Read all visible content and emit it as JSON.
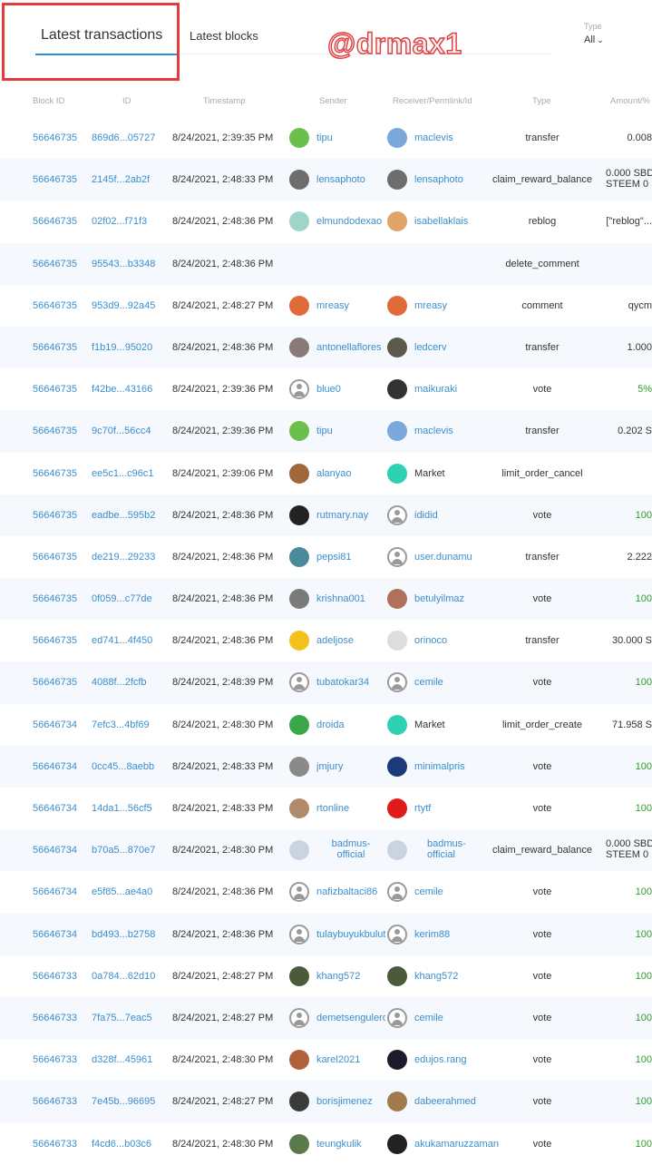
{
  "header": {
    "tab_active": "Latest transactions",
    "tab_other": "Latest blocks",
    "watermark": "@drmax1",
    "type_label": "Type",
    "type_value": "All"
  },
  "columns": [
    "Block ID",
    "ID",
    "Timestamp",
    "Sender",
    "Receiver/Permlink/Id",
    "Type",
    "Amount/%"
  ],
  "colors": {
    "link": "#3a8fcf",
    "accent": "#2a8fd4",
    "highlight_box": "#e23b3b",
    "green_value": "#2e9e2e",
    "row_alt": "#f5f8fc"
  },
  "rows": [
    {
      "block": "56646735",
      "id": "869d6...05727",
      "ts": "8/24/2021, 2:39:35 PM",
      "sender": "tipu",
      "receiver": "maclevis",
      "type": "transfer",
      "amount": "0.008",
      "s_av": "#6bbf4a",
      "r_av": "#7aa8d8"
    },
    {
      "block": "56646735",
      "id": "2145f...2ab2f",
      "ts": "8/24/2021, 2:48:33 PM",
      "sender": "lensaphoto",
      "receiver": "lensaphoto",
      "type": "claim_reward_balance",
      "amount": "0.000 SBD",
      "amount2": "STEEM 0",
      "s_av": "#6d6d6d",
      "r_av": "#6d6d6d"
    },
    {
      "block": "56646735",
      "id": "02f02...f71f3",
      "ts": "8/24/2021, 2:48:36 PM",
      "sender": "elmundodexao",
      "receiver": "isabellaklais",
      "type": "reblog",
      "amount": "[\"reblog\"...",
      "s_av": "#9fd4c9",
      "r_av": "#e0a36a"
    },
    {
      "block": "56646735",
      "id": "95543...b3348",
      "ts": "8/24/2021, 2:48:36 PM",
      "sender": "",
      "receiver": "",
      "type": "delete_comment",
      "amount": ""
    },
    {
      "block": "56646735",
      "id": "953d9...92a45",
      "ts": "8/24/2021, 2:48:27 PM",
      "sender": "mreasy",
      "receiver": "mreasy",
      "type": "comment",
      "amount": "qycm",
      "s_av": "#e06b3a",
      "r_av": "#e06b3a"
    },
    {
      "block": "56646735",
      "id": "f1b19...95020",
      "ts": "8/24/2021, 2:48:36 PM",
      "sender": "antonellaflores",
      "receiver": "ledcerv",
      "type": "transfer",
      "amount": "1.000",
      "s_av": "#8a7a7a",
      "r_av": "#5a5a4a"
    },
    {
      "block": "56646735",
      "id": "f42be...43166",
      "ts": "8/24/2021, 2:39:36 PM",
      "sender": "blue0",
      "receiver": "maikuraki",
      "type": "vote",
      "amount": "5%",
      "green": true,
      "s_av": "default",
      "r_av": "#333333"
    },
    {
      "block": "56646735",
      "id": "9c70f...56cc4",
      "ts": "8/24/2021, 2:39:36 PM",
      "sender": "tipu",
      "receiver": "maclevis",
      "type": "transfer",
      "amount": "0.202 S",
      "s_av": "#6bbf4a",
      "r_av": "#7aa8d8"
    },
    {
      "block": "56646735",
      "id": "ee5c1...c96c1",
      "ts": "8/24/2021, 2:39:06 PM",
      "sender": "alanyao",
      "receiver": "Market",
      "receiver_plain": true,
      "type": "limit_order_cancel",
      "amount": "",
      "s_av": "#a0673a",
      "r_av": "#2fd1b4"
    },
    {
      "block": "56646735",
      "id": "eadbe...595b2",
      "ts": "8/24/2021, 2:48:36 PM",
      "sender": "rutmary.nay",
      "receiver": "ididid",
      "type": "vote",
      "amount": "100",
      "green": true,
      "s_av": "#222222",
      "r_av": "default"
    },
    {
      "block": "56646735",
      "id": "de219...29233",
      "ts": "8/24/2021, 2:48:36 PM",
      "sender": "pepsi81",
      "receiver": "user.dunamu",
      "type": "transfer",
      "amount": "2.222",
      "s_av": "#4a8a9a",
      "r_av": "default"
    },
    {
      "block": "56646735",
      "id": "0f059...c77de",
      "ts": "8/24/2021, 2:48:36 PM",
      "sender": "krishna001",
      "receiver": "betulyilmaz",
      "type": "vote",
      "amount": "100",
      "green": true,
      "s_av": "#7a7a7a",
      "r_av": "#b0705a"
    },
    {
      "block": "56646735",
      "id": "ed741...4f450",
      "ts": "8/24/2021, 2:48:36 PM",
      "sender": "adeljose",
      "receiver": "orinoco",
      "type": "transfer",
      "amount": "30.000 S",
      "s_av": "#f2c21a",
      "r_av": "#dddddd"
    },
    {
      "block": "56646735",
      "id": "4088f...2fcfb",
      "ts": "8/24/2021, 2:48:39 PM",
      "sender": "tubatokar34",
      "receiver": "cemile",
      "type": "vote",
      "amount": "100",
      "green": true,
      "s_av": "default",
      "r_av": "default"
    },
    {
      "block": "56646734",
      "id": "7efc3...4bf69",
      "ts": "8/24/2021, 2:48:30 PM",
      "sender": "droida",
      "receiver": "Market",
      "receiver_plain": true,
      "type": "limit_order_create",
      "amount": "71.958 S",
      "s_av": "#3aa84a",
      "r_av": "#2fd1b4"
    },
    {
      "block": "56646734",
      "id": "0cc45...8aebb",
      "ts": "8/24/2021, 2:48:33 PM",
      "sender": "jmjury",
      "receiver": "minimalpris",
      "type": "vote",
      "amount": "100",
      "green": true,
      "s_av": "#8a8a8a",
      "r_av": "#1a3a7a"
    },
    {
      "block": "56646734",
      "id": "14da1...56cf5",
      "ts": "8/24/2021, 2:48:33 PM",
      "sender": "rtonline",
      "receiver": "rtytf",
      "type": "vote",
      "amount": "100",
      "green": true,
      "s_av": "#b08a6a",
      "r_av": "#e01a1a"
    },
    {
      "block": "56646734",
      "id": "b70a5...870e7",
      "ts": "8/24/2021, 2:48:30 PM",
      "sender": "badmus-",
      "sender2": "official",
      "receiver": "badmus-",
      "receiver2": "official",
      "type": "claim_reward_balance",
      "amount": "0.000 SBD",
      "amount2": "STEEM 0",
      "s_av": "#c9d4e0",
      "r_av": "#c9d4e0"
    },
    {
      "block": "56646734",
      "id": "e5f85...ae4a0",
      "ts": "8/24/2021, 2:48:36 PM",
      "sender": "nafizbaltaci86",
      "receiver": "cemile",
      "type": "vote",
      "amount": "100",
      "green": true,
      "s_av": "default",
      "r_av": "default"
    },
    {
      "block": "56646734",
      "id": "bd493...b2758",
      "ts": "8/24/2021, 2:48:36 PM",
      "sender": "tulaybuyukbulut",
      "receiver": "kerim88",
      "type": "vote",
      "amount": "100",
      "green": true,
      "s_av": "default",
      "r_av": "default"
    },
    {
      "block": "56646733",
      "id": "0a784...62d10",
      "ts": "8/24/2021, 2:48:27 PM",
      "sender": "khang572",
      "receiver": "khang572",
      "type": "vote",
      "amount": "100",
      "green": true,
      "s_av": "#4a5a3a",
      "r_av": "#4a5a3a"
    },
    {
      "block": "56646733",
      "id": "7fa75...7eac5",
      "ts": "8/24/2021, 2:48:27 PM",
      "sender": "demetsenguleroz",
      "receiver": "cemile",
      "type": "vote",
      "amount": "100",
      "green": true,
      "s_av": "default",
      "r_av": "default"
    },
    {
      "block": "56646733",
      "id": "d328f...45961",
      "ts": "8/24/2021, 2:48:30 PM",
      "sender": "karel2021",
      "receiver": "edujos.rang",
      "type": "vote",
      "amount": "100",
      "green": true,
      "s_av": "#b0603a",
      "r_av": "#1a1a2a"
    },
    {
      "block": "56646733",
      "id": "7e45b...96695",
      "ts": "8/24/2021, 2:48:27 PM",
      "sender": "borisjimenez",
      "receiver": "dabeerahmed",
      "type": "vote",
      "amount": "100",
      "green": true,
      "s_av": "#3a3a3a",
      "r_av": "#a07a4a"
    },
    {
      "block": "56646733",
      "id": "f4cd6...b03c6",
      "ts": "8/24/2021, 2:48:30 PM",
      "sender": "teungkulik",
      "receiver": "akukamaruzzaman",
      "type": "vote",
      "amount": "100",
      "green": true,
      "s_av": "#5a7a4a",
      "r_av": "#222222"
    }
  ]
}
